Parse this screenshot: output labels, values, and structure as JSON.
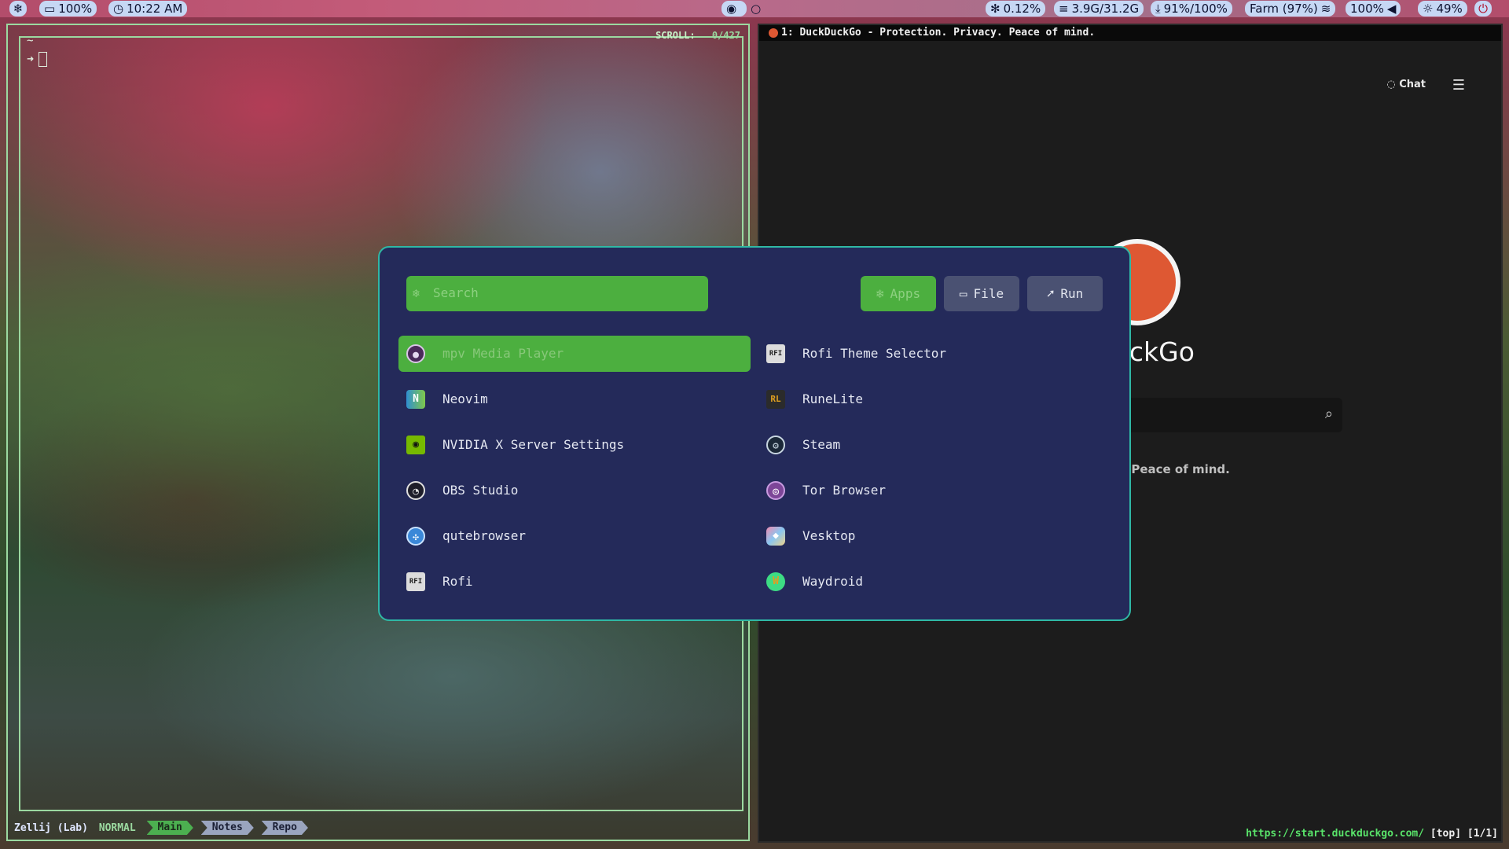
{
  "topbar": {
    "left": {
      "battery": "100%",
      "clock": "10:22 AM"
    },
    "right": {
      "cpu": "0.12%",
      "memory": "3.9G/31.2G",
      "download": "91%/100%",
      "wifi": "Farm (97%)",
      "volume": "100%",
      "brightness": "49%"
    }
  },
  "terminal": {
    "tilde": "~",
    "scroll_label": "SCROLL:",
    "scroll_value": "0/427",
    "prompt_arrow": "➜",
    "statusbar": {
      "app": "Zellij (Lab)",
      "mode": "NORMAL",
      "tabs": [
        "Main",
        "Notes",
        "Repo"
      ]
    }
  },
  "browser": {
    "title": "1: DuckDuckGo - Protection. Privacy. Peace of mind.",
    "chat_label": "Chat",
    "brand_visible": "uckGo",
    "tagline_visible": "y. Peace of mind.",
    "status_url": "https://start.duckduckgo.com/",
    "status_pos": "[top] [1/1]"
  },
  "rofi": {
    "search_placeholder": "Search",
    "modes": [
      {
        "label": "Apps",
        "active": true,
        "icon": "snowflake-icon"
      },
      {
        "label": "File",
        "active": false,
        "icon": "folder-icon"
      },
      {
        "label": "Run",
        "active": false,
        "icon": "rocket-icon"
      }
    ],
    "left_column": [
      {
        "label": "mpv Media Player",
        "icon": "mpv-icon",
        "selected": true
      },
      {
        "label": "Neovim",
        "icon": "neovim-icon"
      },
      {
        "label": "NVIDIA X Server Settings",
        "icon": "nvidia-icon"
      },
      {
        "label": "OBS Studio",
        "icon": "obs-icon"
      },
      {
        "label": "qutebrowser",
        "icon": "qutebrowser-icon"
      },
      {
        "label": "Rofi",
        "icon": "rofi-icon"
      }
    ],
    "right_column": [
      {
        "label": "Rofi Theme Selector",
        "icon": "rofi-icon"
      },
      {
        "label": "RuneLite",
        "icon": "runelite-icon"
      },
      {
        "label": "Steam",
        "icon": "steam-icon"
      },
      {
        "label": "Tor Browser",
        "icon": "tor-icon"
      },
      {
        "label": "Vesktop",
        "icon": "vesktop-icon"
      },
      {
        "label": "Waydroid",
        "icon": "waydroid-icon"
      }
    ]
  },
  "colors": {
    "accent_green": "#4caf3f",
    "rofi_bg": "#242a5a",
    "rofi_border": "#2fb8a5",
    "ddg_orange": "#de5833"
  }
}
